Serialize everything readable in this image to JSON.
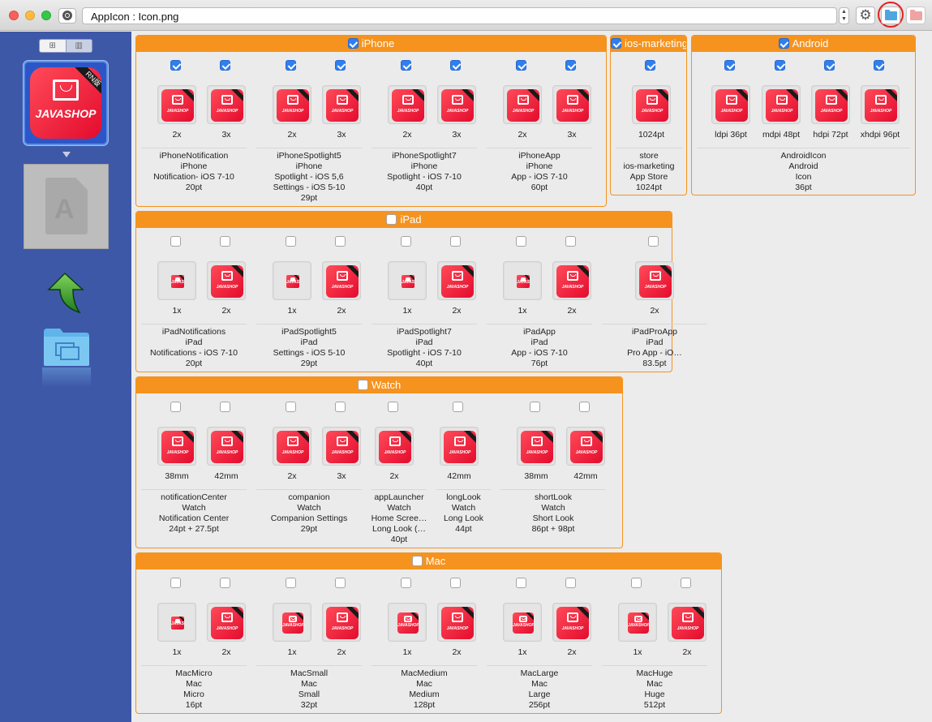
{
  "window": {
    "path": "AppIcon : Icon.png"
  },
  "icon": {
    "brand": "JAVASHOP",
    "ribbon": "RN版"
  },
  "sidebar": {
    "grid_label": "⊞",
    "list_label": "▥"
  },
  "sections": {
    "iphone": {
      "title": "iPhone",
      "checked": true,
      "groups": [
        {
          "slots": [
            {
              "label": "2x",
              "checked": true
            },
            {
              "label": "3x",
              "checked": true
            }
          ],
          "name": "iPhoneNotification",
          "idiom": "iPhone",
          "desc": "Notification- iOS 7-10",
          "size": "20pt"
        },
        {
          "slots": [
            {
              "label": "2x",
              "checked": true
            },
            {
              "label": "3x",
              "checked": true
            }
          ],
          "name": "iPhoneSpotlight5",
          "idiom": "iPhone",
          "desc": "Spotlight - iOS 5,6",
          "desc2": "Settings - iOS 5-10",
          "size": "29pt"
        },
        {
          "slots": [
            {
              "label": "2x",
              "checked": true
            },
            {
              "label": "3x",
              "checked": true
            }
          ],
          "name": "iPhoneSpotlight7",
          "idiom": "iPhone",
          "desc": "Spotlight - iOS 7-10",
          "size": "40pt"
        },
        {
          "slots": [
            {
              "label": "2x",
              "checked": true
            },
            {
              "label": "3x",
              "checked": true
            }
          ],
          "name": "iPhoneApp",
          "idiom": "iPhone",
          "desc": "App - iOS 7-10",
          "size": "60pt"
        }
      ]
    },
    "marketing": {
      "title": "ios-marketing",
      "checked": true,
      "groups": [
        {
          "slots": [
            {
              "label": "1024pt",
              "checked": true
            }
          ],
          "name": "store",
          "idiom": "ios-marketing",
          "desc": "App Store",
          "size": "1024pt"
        }
      ]
    },
    "android": {
      "title": "Android",
      "checked": true,
      "groups": [
        {
          "slots": [
            {
              "label": "ldpi 36pt",
              "checked": true
            },
            {
              "label": "mdpi 48pt",
              "checked": true
            },
            {
              "label": "hdpi 72pt",
              "checked": true
            },
            {
              "label": "xhdpi 96pt",
              "checked": true
            }
          ],
          "name": "AndroidIcon",
          "idiom": "Android",
          "desc": "Icon",
          "size": "36pt"
        }
      ]
    },
    "ipad": {
      "title": "iPad",
      "checked": false,
      "groups": [
        {
          "slots": [
            {
              "label": "1x",
              "checked": false
            },
            {
              "label": "2x",
              "checked": false
            }
          ],
          "name": "iPadNotifications",
          "idiom": "iPad",
          "desc": "Notifications - iOS 7-10",
          "size": "20pt"
        },
        {
          "slots": [
            {
              "label": "1x",
              "checked": false
            },
            {
              "label": "2x",
              "checked": false
            }
          ],
          "name": "iPadSpotlight5",
          "idiom": "iPad",
          "desc": "Settings - iOS 5-10",
          "size": "29pt"
        },
        {
          "slots": [
            {
              "label": "1x",
              "checked": false
            },
            {
              "label": "2x",
              "checked": false
            }
          ],
          "name": "iPadSpotlight7",
          "idiom": "iPad",
          "desc": "Spotlight - iOS 7-10",
          "size": "40pt"
        },
        {
          "slots": [
            {
              "label": "1x",
              "checked": false
            },
            {
              "label": "2x",
              "checked": false
            }
          ],
          "name": "iPadApp",
          "idiom": "iPad",
          "desc": "App - iOS 7-10",
          "size": "76pt"
        },
        {
          "slots": [
            {
              "label": "2x",
              "checked": false
            }
          ],
          "name": "iPadProApp",
          "idiom": "iPad",
          "desc": "Pro App - iO…",
          "size": "83.5pt"
        }
      ]
    },
    "watch": {
      "title": "Watch",
      "checked": false,
      "groups": [
        {
          "slots": [
            {
              "label": "38mm",
              "checked": false
            },
            {
              "label": "42mm",
              "checked": false
            }
          ],
          "name": "notificationCenter",
          "idiom": "Watch",
          "desc": "Notification Center",
          "size": "24pt + 27.5pt"
        },
        {
          "slots": [
            {
              "label": "2x",
              "checked": false
            },
            {
              "label": "3x",
              "checked": false
            }
          ],
          "name": "companion",
          "idiom": "Watch",
          "desc": "Companion Settings",
          "size": "29pt"
        },
        {
          "slots": [
            {
              "label": "2x",
              "checked": false
            }
          ],
          "name": "appLauncher",
          "idiom": "Watch",
          "desc": "Home Scree…",
          "desc2": "Long Look (…",
          "size": "40pt"
        },
        {
          "slots": [
            {
              "label": "42mm",
              "checked": false
            }
          ],
          "name": "longLook",
          "idiom": "Watch",
          "desc": "Long Look",
          "size": "44pt"
        },
        {
          "slots": [
            {
              "label": "38mm",
              "checked": false
            },
            {
              "label": "42mm",
              "checked": false
            }
          ],
          "name": "shortLook",
          "idiom": "Watch",
          "desc": "Short Look",
          "size": "86pt + 98pt"
        }
      ]
    },
    "mac": {
      "title": "Mac",
      "checked": false,
      "groups": [
        {
          "slots": [
            {
              "label": "1x",
              "checked": false
            },
            {
              "label": "2x",
              "checked": false
            }
          ],
          "name": "MacMicro",
          "idiom": "Mac",
          "desc": "Micro",
          "size": "16pt"
        },
        {
          "slots": [
            {
              "label": "1x",
              "checked": false
            },
            {
              "label": "2x",
              "checked": false
            }
          ],
          "name": "MacSmall",
          "idiom": "Mac",
          "desc": "Small",
          "size": "32pt"
        },
        {
          "slots": [
            {
              "label": "1x",
              "checked": false
            },
            {
              "label": "2x",
              "checked": false
            }
          ],
          "name": "MacMedium",
          "idiom": "Mac",
          "desc": "Medium",
          "size": "128pt"
        },
        {
          "slots": [
            {
              "label": "1x",
              "checked": false
            },
            {
              "label": "2x",
              "checked": false
            }
          ],
          "name": "MacLarge",
          "idiom": "Mac",
          "desc": "Large",
          "size": "256pt"
        },
        {
          "slots": [
            {
              "label": "1x",
              "checked": false
            },
            {
              "label": "2x",
              "checked": false
            }
          ],
          "name": "MacHuge",
          "idiom": "Mac",
          "desc": "Huge",
          "size": "512pt"
        }
      ]
    }
  }
}
